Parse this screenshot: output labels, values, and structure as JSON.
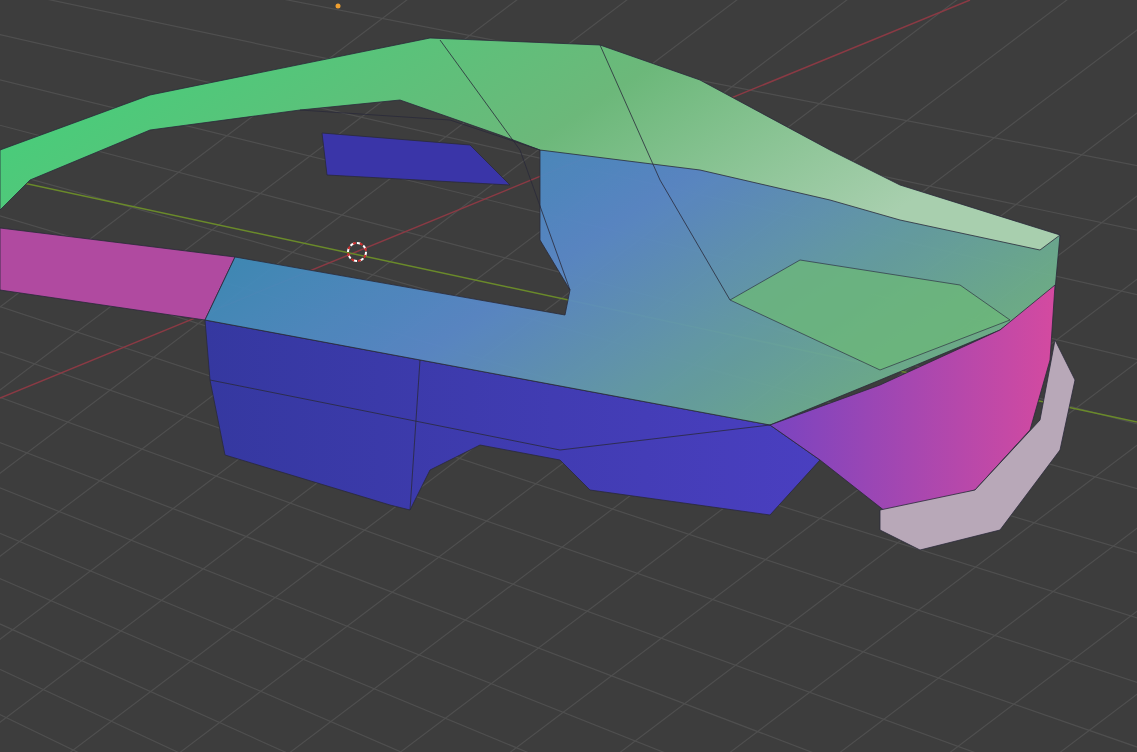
{
  "viewport": {
    "show_grid": true,
    "show_axes": true,
    "show_cursor": true,
    "show_origin": true
  }
}
